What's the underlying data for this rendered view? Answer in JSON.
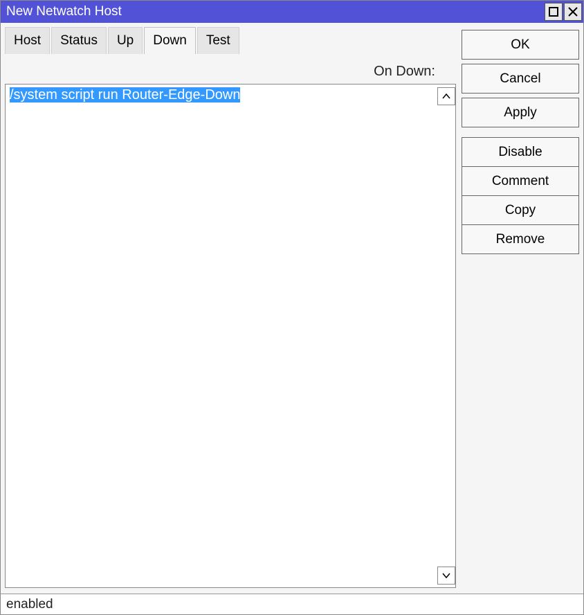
{
  "window": {
    "title": "New Netwatch Host"
  },
  "tabs": {
    "items": [
      {
        "label": "Host",
        "active": false
      },
      {
        "label": "Status",
        "active": false
      },
      {
        "label": "Up",
        "active": false
      },
      {
        "label": "Down",
        "active": true
      },
      {
        "label": "Test",
        "active": false
      }
    ]
  },
  "main": {
    "field_label": "On Down:",
    "script_text": "/system script run Router-Edge-Down",
    "script_selected": true
  },
  "sidebar": {
    "buttons": {
      "ok": "OK",
      "cancel": "Cancel",
      "apply": "Apply",
      "disable": "Disable",
      "comment": "Comment",
      "copy": "Copy",
      "remove": "Remove"
    }
  },
  "status": {
    "text": "enabled"
  }
}
